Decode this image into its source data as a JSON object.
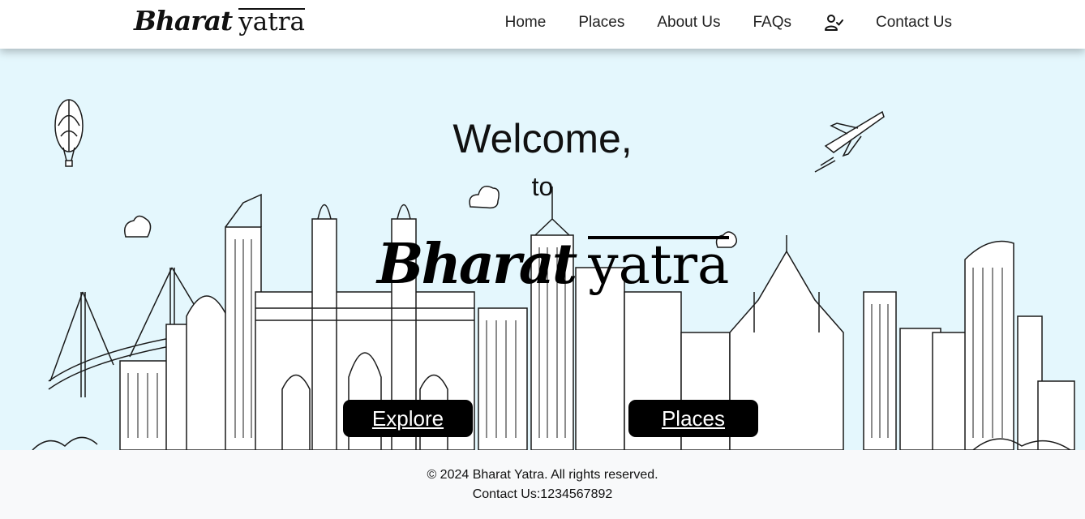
{
  "brand": {
    "bold": "Bharat",
    "script": "yatra"
  },
  "nav": {
    "home": "Home",
    "places": "Places",
    "about": "About Us",
    "faqs": "FAQs",
    "user_icon": "user-check-icon",
    "contact": "Contact Us"
  },
  "hero": {
    "welcome": "Welcome,",
    "to": "to",
    "title_bold": "Bharat",
    "title_script": "yatra",
    "explore_button": "Explore",
    "places_button": "Places",
    "background": "#e4f7fd"
  },
  "footer": {
    "copyright": "© 2024 Bharat Yatra. All rights reserved.",
    "contact": "Contact Us:1234567892"
  }
}
